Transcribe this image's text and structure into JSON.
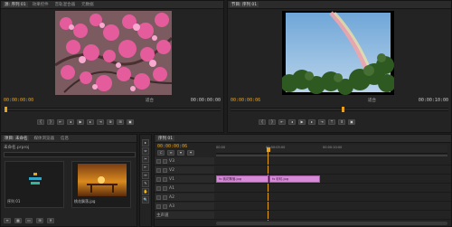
{
  "source_monitor": {
    "tabs": [
      "源: 序列 01",
      "效果控件",
      "音轨混合器",
      "元数据"
    ],
    "timecode_left": "00:00:00:00",
    "timecode_right": "00:00:00:00",
    "zoom": "适合"
  },
  "program_monitor": {
    "tabs": [
      "节目: 序列 01"
    ],
    "timecode_left": "00:00:00:06",
    "timecode_right": "00:00:10:00",
    "zoom": "适合"
  },
  "project": {
    "tabs": [
      "项目: 未命名",
      "媒体浏览器",
      "信息"
    ],
    "project_file": "未命名.prproj",
    "items": [
      {
        "label": "序列 01"
      },
      {
        "label": "桃花飘落.jpg"
      }
    ]
  },
  "timeline": {
    "tabs": [
      "序列 01"
    ],
    "timecode": "00:00:00:06",
    "ruler_labels": [
      "00:00",
      "00:00:05:00",
      "00:00:10:00"
    ],
    "tracks": [
      {
        "name": "V3"
      },
      {
        "name": "V2"
      },
      {
        "name": "V1"
      },
      {
        "name": "A1"
      },
      {
        "name": "A2"
      },
      {
        "name": "A3"
      },
      {
        "name": "主声道"
      }
    ],
    "clips": [
      {
        "label": "fx 桃花飘落.jpg"
      },
      {
        "label": "fx 彩虹.jpg"
      }
    ]
  },
  "tools": [
    "▸",
    "⇔",
    "✂",
    "⇤",
    "↔",
    "✎",
    "✋",
    "🔍"
  ],
  "colors": {
    "accent_timecode": "#e8a21a",
    "clip": "#d68ad7",
    "playhead": "#e8a21a"
  }
}
